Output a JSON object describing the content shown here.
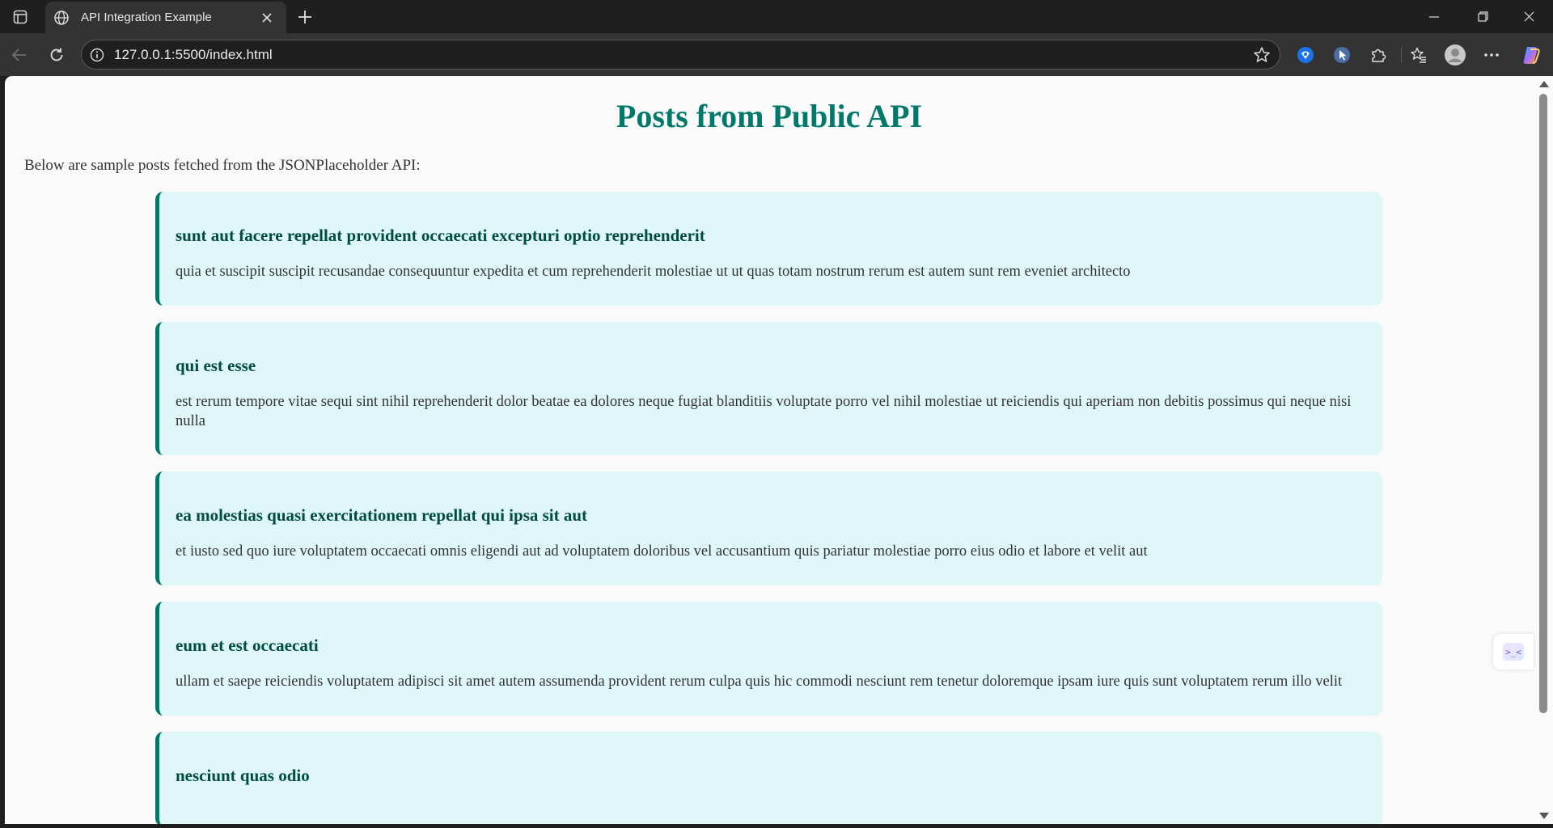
{
  "browser": {
    "tab_title": "API Integration Example",
    "url": "127.0.0.1:5500/index.html",
    "icons": [
      "tab-actions-icon",
      "globe-icon",
      "close-icon",
      "plus-icon",
      "minimize-icon",
      "restore-icon",
      "window-close-icon",
      "back-icon",
      "refresh-icon",
      "info-icon",
      "star-icon",
      "extension-icon",
      "puzzle-icon",
      "favorites-icon",
      "profile-icon",
      "more-icon",
      "copilot-icon"
    ]
  },
  "page": {
    "title": "Posts from Public API",
    "intro": "Below are sample posts fetched from the JSONPlaceholder API:",
    "posts": [
      {
        "title": "sunt aut facere repellat provident occaecati excepturi optio reprehenderit",
        "body": "quia et suscipit suscipit recusandae consequuntur expedita et cum reprehenderit molestiae ut ut quas totam nostrum rerum est autem sunt rem eveniet architecto"
      },
      {
        "title": "qui est esse",
        "body": "est rerum tempore vitae sequi sint nihil reprehenderit dolor beatae ea dolores neque fugiat blanditiis voluptate porro vel nihil molestiae ut reiciendis qui aperiam non debitis possimus qui neque nisi nulla"
      },
      {
        "title": "ea molestias quasi exercitationem repellat qui ipsa sit aut",
        "body": "et iusto sed quo iure voluptatem occaecati omnis eligendi aut ad voluptatem doloribus vel accusantium quis pariatur molestiae porro eius odio et labore et velit aut"
      },
      {
        "title": "eum et est occaecati",
        "body": "ullam et saepe reiciendis voluptatem adipisci sit amet autem assumenda provident rerum culpa quis hic commodi nesciunt rem tenetur doloremque ipsam iure quis sunt voluptatem rerum illo velit"
      },
      {
        "title": "nesciunt quas odio",
        "body": ""
      }
    ]
  },
  "colors": {
    "title": "#00796b",
    "post_title": "#004d40",
    "post_bg": "#e0f7fa",
    "post_border": "#00796b",
    "chrome_dark": "#1f1f1f",
    "chrome_mid": "#333333"
  }
}
